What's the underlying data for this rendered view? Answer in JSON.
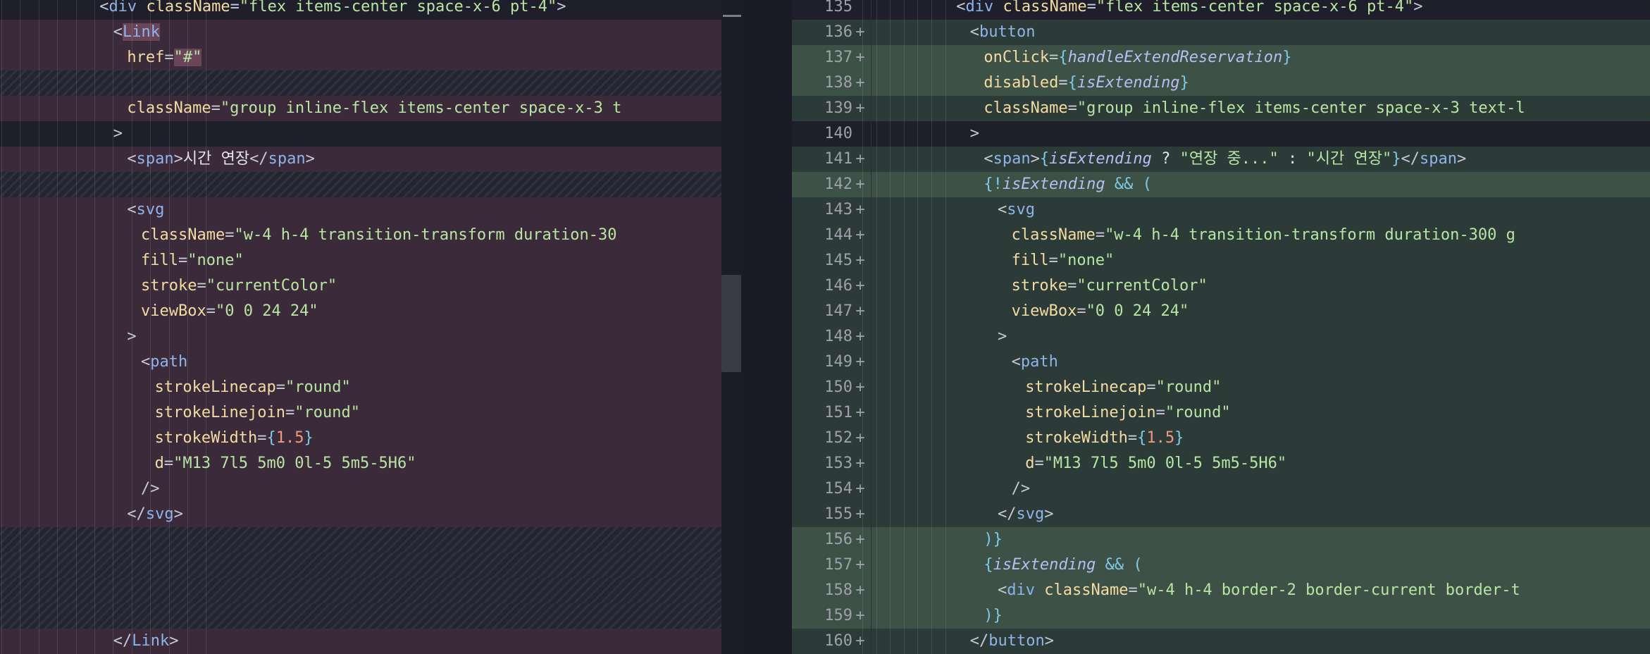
{
  "left_pane": {
    "lines": [
      {
        "bg": "plain",
        "indent": 7,
        "tokens": [
          [
            "punct",
            "<"
          ],
          [
            "tag",
            "div"
          ],
          [
            "text",
            " "
          ],
          [
            "attr",
            "className"
          ],
          [
            "punct",
            "="
          ],
          [
            "str",
            "\"flex items-center space-x-6 pt-4\""
          ],
          [
            "punct",
            ">"
          ]
        ]
      },
      {
        "bg": "del",
        "indent": 8,
        "tokens": [
          [
            "punct",
            "<"
          ],
          [
            "tag",
            "Link"
          ]
        ],
        "hl": true
      },
      {
        "bg": "del",
        "indent": 9,
        "tokens": [
          [
            "attr",
            "href"
          ],
          [
            "punct",
            "="
          ],
          [
            "str",
            "\"#\""
          ]
        ],
        "hl": true
      },
      {
        "bg": "hatch",
        "indent": 0,
        "tokens": []
      },
      {
        "bg": "del",
        "indent": 9,
        "tokens": [
          [
            "attr",
            "className"
          ],
          [
            "punct",
            "="
          ],
          [
            "str",
            "\"group inline-flex items-center space-x-3 t"
          ]
        ]
      },
      {
        "bg": "plain",
        "indent": 8,
        "tokens": [
          [
            "punct",
            ">"
          ]
        ]
      },
      {
        "bg": "del",
        "indent": 9,
        "tokens": [
          [
            "punct",
            "<"
          ],
          [
            "tag",
            "span"
          ],
          [
            "punct",
            ">"
          ],
          [
            "text",
            "시간 연장"
          ],
          [
            "punct",
            "</"
          ],
          [
            "tag",
            "span"
          ],
          [
            "punct",
            ">"
          ]
        ]
      },
      {
        "bg": "hatch",
        "indent": 0,
        "tokens": []
      },
      {
        "bg": "del",
        "indent": 9,
        "tokens": [
          [
            "punct",
            "<"
          ],
          [
            "tag",
            "svg"
          ]
        ]
      },
      {
        "bg": "del",
        "indent": 10,
        "tokens": [
          [
            "attr",
            "className"
          ],
          [
            "punct",
            "="
          ],
          [
            "str",
            "\"w-4 h-4 transition-transform duration-30"
          ]
        ]
      },
      {
        "bg": "del",
        "indent": 10,
        "tokens": [
          [
            "attr",
            "fill"
          ],
          [
            "punct",
            "="
          ],
          [
            "str",
            "\"none\""
          ]
        ]
      },
      {
        "bg": "del",
        "indent": 10,
        "tokens": [
          [
            "attr",
            "stroke"
          ],
          [
            "punct",
            "="
          ],
          [
            "str",
            "\"currentColor\""
          ]
        ]
      },
      {
        "bg": "del",
        "indent": 10,
        "tokens": [
          [
            "attr",
            "viewBox"
          ],
          [
            "punct",
            "="
          ],
          [
            "str",
            "\"0 0 24 24\""
          ]
        ]
      },
      {
        "bg": "del",
        "indent": 9,
        "tokens": [
          [
            "punct",
            ">"
          ]
        ]
      },
      {
        "bg": "del",
        "indent": 10,
        "tokens": [
          [
            "punct",
            "<"
          ],
          [
            "tag",
            "path"
          ]
        ]
      },
      {
        "bg": "del",
        "indent": 11,
        "tokens": [
          [
            "attr",
            "strokeLinecap"
          ],
          [
            "punct",
            "="
          ],
          [
            "str",
            "\"round\""
          ]
        ]
      },
      {
        "bg": "del",
        "indent": 11,
        "tokens": [
          [
            "attr",
            "strokeLinejoin"
          ],
          [
            "punct",
            "="
          ],
          [
            "str",
            "\"round\""
          ]
        ]
      },
      {
        "bg": "del",
        "indent": 11,
        "tokens": [
          [
            "attr",
            "strokeWidth"
          ],
          [
            "punct",
            "="
          ],
          [
            "brace",
            "{"
          ],
          [
            "num",
            "1.5"
          ],
          [
            "brace",
            "}"
          ]
        ]
      },
      {
        "bg": "del",
        "indent": 11,
        "tokens": [
          [
            "attr",
            "d"
          ],
          [
            "punct",
            "="
          ],
          [
            "str",
            "\"M13 7l5 5m0 0l-5 5m5-5H6\""
          ]
        ]
      },
      {
        "bg": "del",
        "indent": 10,
        "tokens": [
          [
            "punct",
            "/>"
          ]
        ]
      },
      {
        "bg": "del",
        "indent": 9,
        "tokens": [
          [
            "punct",
            "</"
          ],
          [
            "tag",
            "svg"
          ],
          [
            "punct",
            ">"
          ]
        ]
      },
      {
        "bg": "hatch",
        "indent": 0,
        "tokens": []
      },
      {
        "bg": "hatch",
        "indent": 0,
        "tokens": []
      },
      {
        "bg": "hatch",
        "indent": 0,
        "tokens": []
      },
      {
        "bg": "hatch",
        "indent": 0,
        "tokens": []
      },
      {
        "bg": "del",
        "indent": 8,
        "tokens": [
          [
            "punct",
            "</"
          ],
          [
            "tag",
            "Link"
          ],
          [
            "punct",
            ">"
          ]
        ]
      }
    ]
  },
  "right_pane": {
    "lines": [
      {
        "num": "135",
        "plus": "",
        "bg": "plain",
        "indent": 7,
        "tokens": [
          [
            "punct",
            "<"
          ],
          [
            "tag",
            "div"
          ],
          [
            "text",
            " "
          ],
          [
            "attr",
            "className"
          ],
          [
            "punct",
            "="
          ],
          [
            "str",
            "\"flex items-center space-x-6 pt-4\""
          ],
          [
            "punct",
            ">"
          ]
        ]
      },
      {
        "num": "136",
        "plus": "+",
        "bg": "add",
        "indent": 8,
        "tokens": [
          [
            "punct",
            "<"
          ],
          [
            "tag",
            "button"
          ]
        ]
      },
      {
        "num": "137",
        "plus": "+",
        "bg": "addstrong",
        "indent": 9,
        "tokens": [
          [
            "attr",
            "onClick"
          ],
          [
            "punct",
            "="
          ],
          [
            "brace",
            "{"
          ],
          [
            "var",
            "handleExtendReservation"
          ],
          [
            "brace",
            "}"
          ]
        ]
      },
      {
        "num": "138",
        "plus": "+",
        "bg": "addstrong",
        "indent": 9,
        "tokens": [
          [
            "attr",
            "disabled"
          ],
          [
            "punct",
            "="
          ],
          [
            "brace",
            "{"
          ],
          [
            "var",
            "isExtending"
          ],
          [
            "brace",
            "}"
          ]
        ]
      },
      {
        "num": "139",
        "plus": "+",
        "bg": "add",
        "indent": 9,
        "tokens": [
          [
            "attr",
            "className"
          ],
          [
            "punct",
            "="
          ],
          [
            "str",
            "\"group inline-flex items-center space-x-3 text-l"
          ]
        ]
      },
      {
        "num": "140",
        "plus": "",
        "bg": "plain",
        "indent": 8,
        "tokens": [
          [
            "punct",
            ">"
          ]
        ]
      },
      {
        "num": "141",
        "plus": "+",
        "bg": "add",
        "indent": 9,
        "tokens": [
          [
            "punct",
            "<"
          ],
          [
            "tag",
            "span"
          ],
          [
            "punct",
            ">"
          ],
          [
            "brace",
            "{"
          ],
          [
            "var",
            "isExtending"
          ],
          [
            "text",
            " ? "
          ],
          [
            "str",
            "\"연장 중...\""
          ],
          [
            "text",
            " : "
          ],
          [
            "str",
            "\"시간 연장\""
          ],
          [
            "brace",
            "}"
          ],
          [
            "punct",
            "</"
          ],
          [
            "tag",
            "span"
          ],
          [
            "punct",
            ">"
          ]
        ]
      },
      {
        "num": "142",
        "plus": "+",
        "bg": "addstrong",
        "indent": 9,
        "tokens": [
          [
            "brace",
            "{"
          ],
          [
            "op",
            "!"
          ],
          [
            "var",
            "isExtending"
          ],
          [
            "text",
            " "
          ],
          [
            "op",
            "&&"
          ],
          [
            "text",
            " "
          ],
          [
            "brace",
            "("
          ]
        ]
      },
      {
        "num": "143",
        "plus": "+",
        "bg": "add",
        "indent": 10,
        "tokens": [
          [
            "punct",
            "<"
          ],
          [
            "tag",
            "svg"
          ]
        ]
      },
      {
        "num": "144",
        "plus": "+",
        "bg": "add",
        "indent": 11,
        "tokens": [
          [
            "attr",
            "className"
          ],
          [
            "punct",
            "="
          ],
          [
            "str",
            "\"w-4 h-4 transition-transform duration-300 g"
          ]
        ]
      },
      {
        "num": "145",
        "plus": "+",
        "bg": "add",
        "indent": 11,
        "tokens": [
          [
            "attr",
            "fill"
          ],
          [
            "punct",
            "="
          ],
          [
            "str",
            "\"none\""
          ]
        ]
      },
      {
        "num": "146",
        "plus": "+",
        "bg": "add",
        "indent": 11,
        "tokens": [
          [
            "attr",
            "stroke"
          ],
          [
            "punct",
            "="
          ],
          [
            "str",
            "\"currentColor\""
          ]
        ]
      },
      {
        "num": "147",
        "plus": "+",
        "bg": "add",
        "indent": 11,
        "tokens": [
          [
            "attr",
            "viewBox"
          ],
          [
            "punct",
            "="
          ],
          [
            "str",
            "\"0 0 24 24\""
          ]
        ]
      },
      {
        "num": "148",
        "plus": "+",
        "bg": "add",
        "indent": 10,
        "tokens": [
          [
            "punct",
            ">"
          ]
        ]
      },
      {
        "num": "149",
        "plus": "+",
        "bg": "add",
        "indent": 11,
        "tokens": [
          [
            "punct",
            "<"
          ],
          [
            "tag",
            "path"
          ]
        ]
      },
      {
        "num": "150",
        "plus": "+",
        "bg": "add",
        "indent": 12,
        "tokens": [
          [
            "attr",
            "strokeLinecap"
          ],
          [
            "punct",
            "="
          ],
          [
            "str",
            "\"round\""
          ]
        ]
      },
      {
        "num": "151",
        "plus": "+",
        "bg": "add",
        "indent": 12,
        "tokens": [
          [
            "attr",
            "strokeLinejoin"
          ],
          [
            "punct",
            "="
          ],
          [
            "str",
            "\"round\""
          ]
        ]
      },
      {
        "num": "152",
        "plus": "+",
        "bg": "add",
        "indent": 12,
        "tokens": [
          [
            "attr",
            "strokeWidth"
          ],
          [
            "punct",
            "="
          ],
          [
            "brace",
            "{"
          ],
          [
            "num",
            "1.5"
          ],
          [
            "brace",
            "}"
          ]
        ]
      },
      {
        "num": "153",
        "plus": "+",
        "bg": "add",
        "indent": 12,
        "tokens": [
          [
            "attr",
            "d"
          ],
          [
            "punct",
            "="
          ],
          [
            "str",
            "\"M13 7l5 5m0 0l-5 5m5-5H6\""
          ]
        ]
      },
      {
        "num": "154",
        "plus": "+",
        "bg": "add",
        "indent": 11,
        "tokens": [
          [
            "punct",
            "/>"
          ]
        ]
      },
      {
        "num": "155",
        "plus": "+",
        "bg": "add",
        "indent": 10,
        "tokens": [
          [
            "punct",
            "</"
          ],
          [
            "tag",
            "svg"
          ],
          [
            "punct",
            ">"
          ]
        ]
      },
      {
        "num": "156",
        "plus": "+",
        "bg": "addstrong",
        "indent": 9,
        "tokens": [
          [
            "brace",
            ")}"
          ]
        ]
      },
      {
        "num": "157",
        "plus": "+",
        "bg": "addstrong",
        "indent": 9,
        "tokens": [
          [
            "brace",
            "{"
          ],
          [
            "var",
            "isExtending"
          ],
          [
            "text",
            " "
          ],
          [
            "op",
            "&&"
          ],
          [
            "text",
            " "
          ],
          [
            "brace",
            "("
          ]
        ]
      },
      {
        "num": "158",
        "plus": "+",
        "bg": "addstrong",
        "indent": 10,
        "tokens": [
          [
            "punct",
            "<"
          ],
          [
            "tag",
            "div"
          ],
          [
            "text",
            " "
          ],
          [
            "attr",
            "className"
          ],
          [
            "punct",
            "="
          ],
          [
            "str",
            "\"w-4 h-4 border-2 border-current border-t"
          ]
        ]
      },
      {
        "num": "159",
        "plus": "+",
        "bg": "addstrong",
        "indent": 9,
        "tokens": [
          [
            "brace",
            ")}"
          ]
        ]
      },
      {
        "num": "160",
        "plus": "+",
        "bg": "add",
        "indent": 8,
        "tokens": [
          [
            "punct",
            "</"
          ],
          [
            "tag",
            "button"
          ],
          [
            "punct",
            ">"
          ]
        ]
      }
    ]
  },
  "colors": {
    "background": "#1e1f2b",
    "deleted_line": "#3b2b3a",
    "added_line": "#2c3a38",
    "added_line_strong": "#3d5147",
    "tag": "#8fb4ea",
    "attribute": "#f2dca2",
    "string": "#b9e5a2"
  }
}
